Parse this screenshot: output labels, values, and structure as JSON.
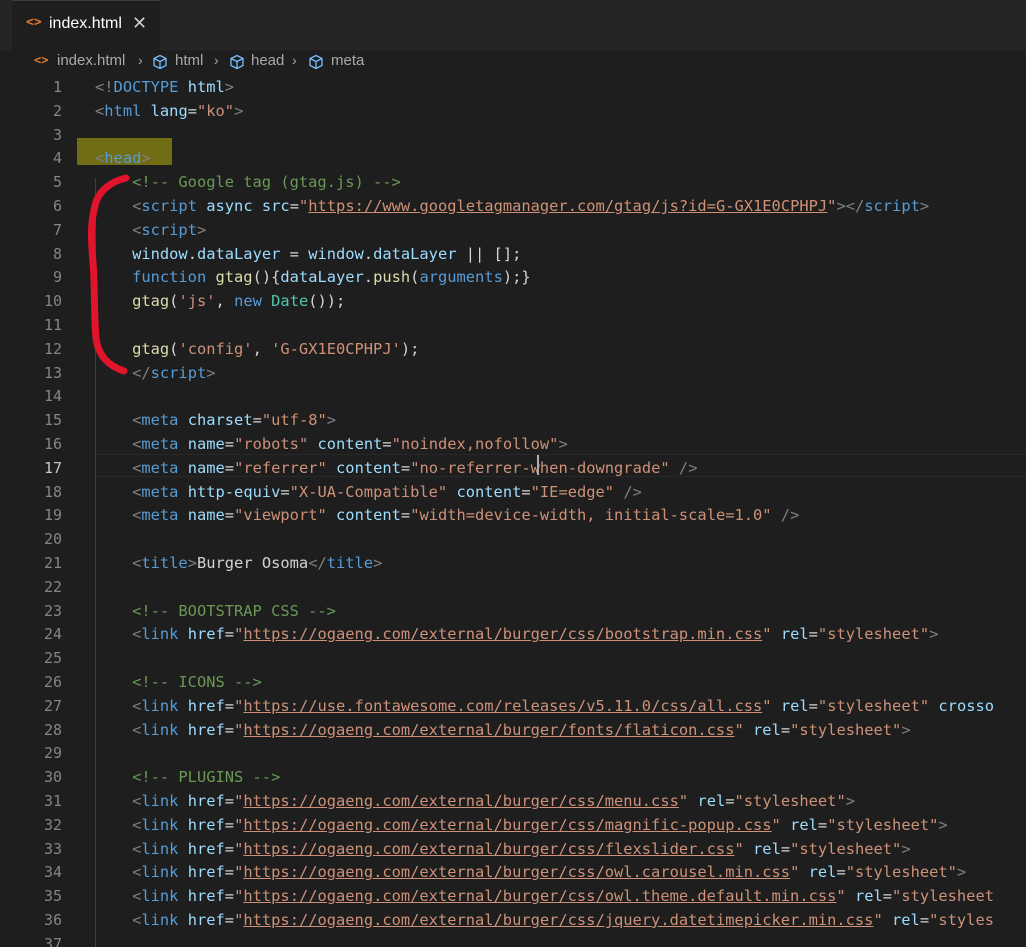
{
  "tab": {
    "icon": "html-file-icon",
    "label": "index.html",
    "close": "✕"
  },
  "breadcrumb": {
    "file": "index.html",
    "items": [
      "html",
      "head",
      "meta"
    ]
  },
  "active_line": 17,
  "lines": [
    [
      [
        "t",
        "<!"
      ],
      [
        "tag",
        "DOCTYPE"
      ],
      [
        "punct",
        " "
      ],
      [
        "attr",
        "html"
      ],
      [
        "t",
        ">"
      ]
    ],
    [
      [
        "t",
        "<"
      ],
      [
        "tag",
        "html"
      ],
      [
        "punct",
        " "
      ],
      [
        "attr",
        "lang"
      ],
      [
        "punct",
        "="
      ],
      [
        "str",
        "\"ko\""
      ],
      [
        "t",
        ">"
      ]
    ],
    [],
    [
      [
        "t",
        "<"
      ],
      [
        "tag",
        "head"
      ],
      [
        "t",
        ">"
      ]
    ],
    [
      [
        "punct",
        "    "
      ],
      [
        "cmt",
        "<!-- Google tag (gtag.js) -->"
      ]
    ],
    [
      [
        "punct",
        "    "
      ],
      [
        "t",
        "<"
      ],
      [
        "tag",
        "script"
      ],
      [
        "punct",
        " "
      ],
      [
        "attr",
        "async"
      ],
      [
        "punct",
        " "
      ],
      [
        "attr",
        "src"
      ],
      [
        "punct",
        "="
      ],
      [
        "str",
        "\""
      ],
      [
        "str url",
        "https://www.googletagmanager.com/gtag/js?id=G-GX1E0CPHPJ"
      ],
      [
        "str",
        "\""
      ],
      [
        "t",
        "></"
      ],
      [
        "tag",
        "script"
      ],
      [
        "t",
        ">"
      ]
    ],
    [
      [
        "punct",
        "    "
      ],
      [
        "t",
        "<"
      ],
      [
        "tag",
        "script"
      ],
      [
        "t",
        ">"
      ]
    ],
    [
      [
        "punct",
        "    "
      ],
      [
        "var",
        "window"
      ],
      [
        "punct",
        "."
      ],
      [
        "var",
        "dataLayer"
      ],
      [
        "punct",
        " = "
      ],
      [
        "var",
        "window"
      ],
      [
        "punct",
        "."
      ],
      [
        "var",
        "dataLayer"
      ],
      [
        "punct",
        " || [];"
      ]
    ],
    [
      [
        "punct",
        "    "
      ],
      [
        "kw",
        "function"
      ],
      [
        "punct",
        " "
      ],
      [
        "fn",
        "gtag"
      ],
      [
        "punct",
        "(){"
      ],
      [
        "var",
        "dataLayer"
      ],
      [
        "punct",
        "."
      ],
      [
        "fn",
        "push"
      ],
      [
        "punct",
        "("
      ],
      [
        "kw",
        "arguments"
      ],
      [
        "punct",
        ");}"
      ]
    ],
    [
      [
        "punct",
        "    "
      ],
      [
        "fn",
        "gtag"
      ],
      [
        "punct",
        "("
      ],
      [
        "str",
        "'js'"
      ],
      [
        "punct",
        ", "
      ],
      [
        "kw",
        "new"
      ],
      [
        "punct",
        " "
      ],
      [
        "cls",
        "Date"
      ],
      [
        "punct",
        "());"
      ]
    ],
    [],
    [
      [
        "punct",
        "    "
      ],
      [
        "fn",
        "gtag"
      ],
      [
        "punct",
        "("
      ],
      [
        "str",
        "'config'"
      ],
      [
        "punct",
        ", "
      ],
      [
        "str",
        "'G-GX1E0CPHPJ'"
      ],
      [
        "punct",
        ");"
      ]
    ],
    [
      [
        "punct",
        "    "
      ],
      [
        "t",
        "</"
      ],
      [
        "tag",
        "script"
      ],
      [
        "t",
        ">"
      ]
    ],
    [],
    [
      [
        "punct",
        "    "
      ],
      [
        "t",
        "<"
      ],
      [
        "tag",
        "meta"
      ],
      [
        "punct",
        " "
      ],
      [
        "attr",
        "charset"
      ],
      [
        "punct",
        "="
      ],
      [
        "str",
        "\"utf-8\""
      ],
      [
        "t",
        ">"
      ]
    ],
    [
      [
        "punct",
        "    "
      ],
      [
        "t",
        "<"
      ],
      [
        "tag",
        "meta"
      ],
      [
        "punct",
        " "
      ],
      [
        "attr",
        "name"
      ],
      [
        "punct",
        "="
      ],
      [
        "str",
        "\"robots\""
      ],
      [
        "punct",
        " "
      ],
      [
        "attr",
        "content"
      ],
      [
        "punct",
        "="
      ],
      [
        "str",
        "\"noindex,nofollow\""
      ],
      [
        "t",
        ">"
      ]
    ],
    [
      [
        "punct",
        "    "
      ],
      [
        "t",
        "<"
      ],
      [
        "tag",
        "meta"
      ],
      [
        "punct",
        " "
      ],
      [
        "attr",
        "name"
      ],
      [
        "punct",
        "="
      ],
      [
        "str",
        "\"referrer\""
      ],
      [
        "punct",
        " "
      ],
      [
        "attr",
        "content"
      ],
      [
        "punct",
        "="
      ],
      [
        "str",
        "\"no-referrer-when-downgrade\""
      ],
      [
        "punct",
        " "
      ],
      [
        "t",
        "/>"
      ]
    ],
    [
      [
        "punct",
        "    "
      ],
      [
        "t",
        "<"
      ],
      [
        "tag",
        "meta"
      ],
      [
        "punct",
        " "
      ],
      [
        "attr",
        "http-equiv"
      ],
      [
        "punct",
        "="
      ],
      [
        "str",
        "\"X-UA-Compatible\""
      ],
      [
        "punct",
        " "
      ],
      [
        "attr",
        "content"
      ],
      [
        "punct",
        "="
      ],
      [
        "str",
        "\"IE=edge\""
      ],
      [
        "punct",
        " "
      ],
      [
        "t",
        "/>"
      ]
    ],
    [
      [
        "punct",
        "    "
      ],
      [
        "t",
        "<"
      ],
      [
        "tag",
        "meta"
      ],
      [
        "punct",
        " "
      ],
      [
        "attr",
        "name"
      ],
      [
        "punct",
        "="
      ],
      [
        "str",
        "\"viewport\""
      ],
      [
        "punct",
        " "
      ],
      [
        "attr",
        "content"
      ],
      [
        "punct",
        "="
      ],
      [
        "str",
        "\"width=device-width, initial-scale=1.0\""
      ],
      [
        "punct",
        " "
      ],
      [
        "t",
        "/>"
      ]
    ],
    [],
    [
      [
        "punct",
        "    "
      ],
      [
        "t",
        "<"
      ],
      [
        "tag",
        "title"
      ],
      [
        "t",
        ">"
      ],
      [
        "punct",
        "Burger Osoma"
      ],
      [
        "t",
        "</"
      ],
      [
        "tag",
        "title"
      ],
      [
        "t",
        ">"
      ]
    ],
    [],
    [
      [
        "punct",
        "    "
      ],
      [
        "cmt",
        "<!-- BOOTSTRAP CSS -->"
      ]
    ],
    [
      [
        "punct",
        "    "
      ],
      [
        "t",
        "<"
      ],
      [
        "tag",
        "link"
      ],
      [
        "punct",
        " "
      ],
      [
        "attr",
        "href"
      ],
      [
        "punct",
        "="
      ],
      [
        "str",
        "\""
      ],
      [
        "str url",
        "https://ogaeng.com/external/burger/css/bootstrap.min.css"
      ],
      [
        "str",
        "\""
      ],
      [
        "punct",
        " "
      ],
      [
        "attr",
        "rel"
      ],
      [
        "punct",
        "="
      ],
      [
        "str",
        "\"stylesheet\""
      ],
      [
        "t",
        ">"
      ]
    ],
    [],
    [
      [
        "punct",
        "    "
      ],
      [
        "cmt",
        "<!-- ICONS -->"
      ]
    ],
    [
      [
        "punct",
        "    "
      ],
      [
        "t",
        "<"
      ],
      [
        "tag",
        "link"
      ],
      [
        "punct",
        " "
      ],
      [
        "attr",
        "href"
      ],
      [
        "punct",
        "="
      ],
      [
        "str",
        "\""
      ],
      [
        "str url",
        "https://use.fontawesome.com/releases/v5.11.0/css/all.css"
      ],
      [
        "str",
        "\""
      ],
      [
        "punct",
        " "
      ],
      [
        "attr",
        "rel"
      ],
      [
        "punct",
        "="
      ],
      [
        "str",
        "\"stylesheet\""
      ],
      [
        "punct",
        " "
      ],
      [
        "attr",
        "crosso"
      ]
    ],
    [
      [
        "punct",
        "    "
      ],
      [
        "t",
        "<"
      ],
      [
        "tag",
        "link"
      ],
      [
        "punct",
        " "
      ],
      [
        "attr",
        "href"
      ],
      [
        "punct",
        "="
      ],
      [
        "str",
        "\""
      ],
      [
        "str url",
        "https://ogaeng.com/external/burger/fonts/flaticon.css"
      ],
      [
        "str",
        "\""
      ],
      [
        "punct",
        " "
      ],
      [
        "attr",
        "rel"
      ],
      [
        "punct",
        "="
      ],
      [
        "str",
        "\"stylesheet\""
      ],
      [
        "t",
        ">"
      ]
    ],
    [],
    [
      [
        "punct",
        "    "
      ],
      [
        "cmt",
        "<!-- PLUGINS -->"
      ]
    ],
    [
      [
        "punct",
        "    "
      ],
      [
        "t",
        "<"
      ],
      [
        "tag",
        "link"
      ],
      [
        "punct",
        " "
      ],
      [
        "attr",
        "href"
      ],
      [
        "punct",
        "="
      ],
      [
        "str",
        "\""
      ],
      [
        "str url",
        "https://ogaeng.com/external/burger/css/menu.css"
      ],
      [
        "str",
        "\""
      ],
      [
        "punct",
        " "
      ],
      [
        "attr",
        "rel"
      ],
      [
        "punct",
        "="
      ],
      [
        "str",
        "\"stylesheet\""
      ],
      [
        "t",
        ">"
      ]
    ],
    [
      [
        "punct",
        "    "
      ],
      [
        "t",
        "<"
      ],
      [
        "tag",
        "link"
      ],
      [
        "punct",
        " "
      ],
      [
        "attr",
        "href"
      ],
      [
        "punct",
        "="
      ],
      [
        "str",
        "\""
      ],
      [
        "str url",
        "https://ogaeng.com/external/burger/css/magnific-popup.css"
      ],
      [
        "str",
        "\""
      ],
      [
        "punct",
        " "
      ],
      [
        "attr",
        "rel"
      ],
      [
        "punct",
        "="
      ],
      [
        "str",
        "\"stylesheet\""
      ],
      [
        "t",
        ">"
      ]
    ],
    [
      [
        "punct",
        "    "
      ],
      [
        "t",
        "<"
      ],
      [
        "tag",
        "link"
      ],
      [
        "punct",
        " "
      ],
      [
        "attr",
        "href"
      ],
      [
        "punct",
        "="
      ],
      [
        "str",
        "\""
      ],
      [
        "str url",
        "https://ogaeng.com/external/burger/css/flexslider.css"
      ],
      [
        "str",
        "\""
      ],
      [
        "punct",
        " "
      ],
      [
        "attr",
        "rel"
      ],
      [
        "punct",
        "="
      ],
      [
        "str",
        "\"stylesheet\""
      ],
      [
        "t",
        ">"
      ]
    ],
    [
      [
        "punct",
        "    "
      ],
      [
        "t",
        "<"
      ],
      [
        "tag",
        "link"
      ],
      [
        "punct",
        " "
      ],
      [
        "attr",
        "href"
      ],
      [
        "punct",
        "="
      ],
      [
        "str",
        "\""
      ],
      [
        "str url",
        "https://ogaeng.com/external/burger/css/owl.carousel.min.css"
      ],
      [
        "str",
        "\""
      ],
      [
        "punct",
        " "
      ],
      [
        "attr",
        "rel"
      ],
      [
        "punct",
        "="
      ],
      [
        "str",
        "\"stylesheet\""
      ],
      [
        "t",
        ">"
      ]
    ],
    [
      [
        "punct",
        "    "
      ],
      [
        "t",
        "<"
      ],
      [
        "tag",
        "link"
      ],
      [
        "punct",
        " "
      ],
      [
        "attr",
        "href"
      ],
      [
        "punct",
        "="
      ],
      [
        "str",
        "\""
      ],
      [
        "str url",
        "https://ogaeng.com/external/burger/css/owl.theme.default.min.css"
      ],
      [
        "str",
        "\""
      ],
      [
        "punct",
        " "
      ],
      [
        "attr",
        "rel"
      ],
      [
        "punct",
        "="
      ],
      [
        "str",
        "\"stylesheet"
      ]
    ],
    [
      [
        "punct",
        "    "
      ],
      [
        "t",
        "<"
      ],
      [
        "tag",
        "link"
      ],
      [
        "punct",
        " "
      ],
      [
        "attr",
        "href"
      ],
      [
        "punct",
        "="
      ],
      [
        "str",
        "\""
      ],
      [
        "str url",
        "https://ogaeng.com/external/burger/css/jquery.datetimepicker.min.css"
      ],
      [
        "str",
        "\""
      ],
      [
        "punct",
        " "
      ],
      [
        "attr",
        "rel"
      ],
      [
        "punct",
        "="
      ],
      [
        "str",
        "\"styles"
      ]
    ],
    []
  ],
  "colors": {
    "background": "#1e1e1e",
    "annotation": "#e0142b",
    "head_highlight": "#716d14"
  }
}
